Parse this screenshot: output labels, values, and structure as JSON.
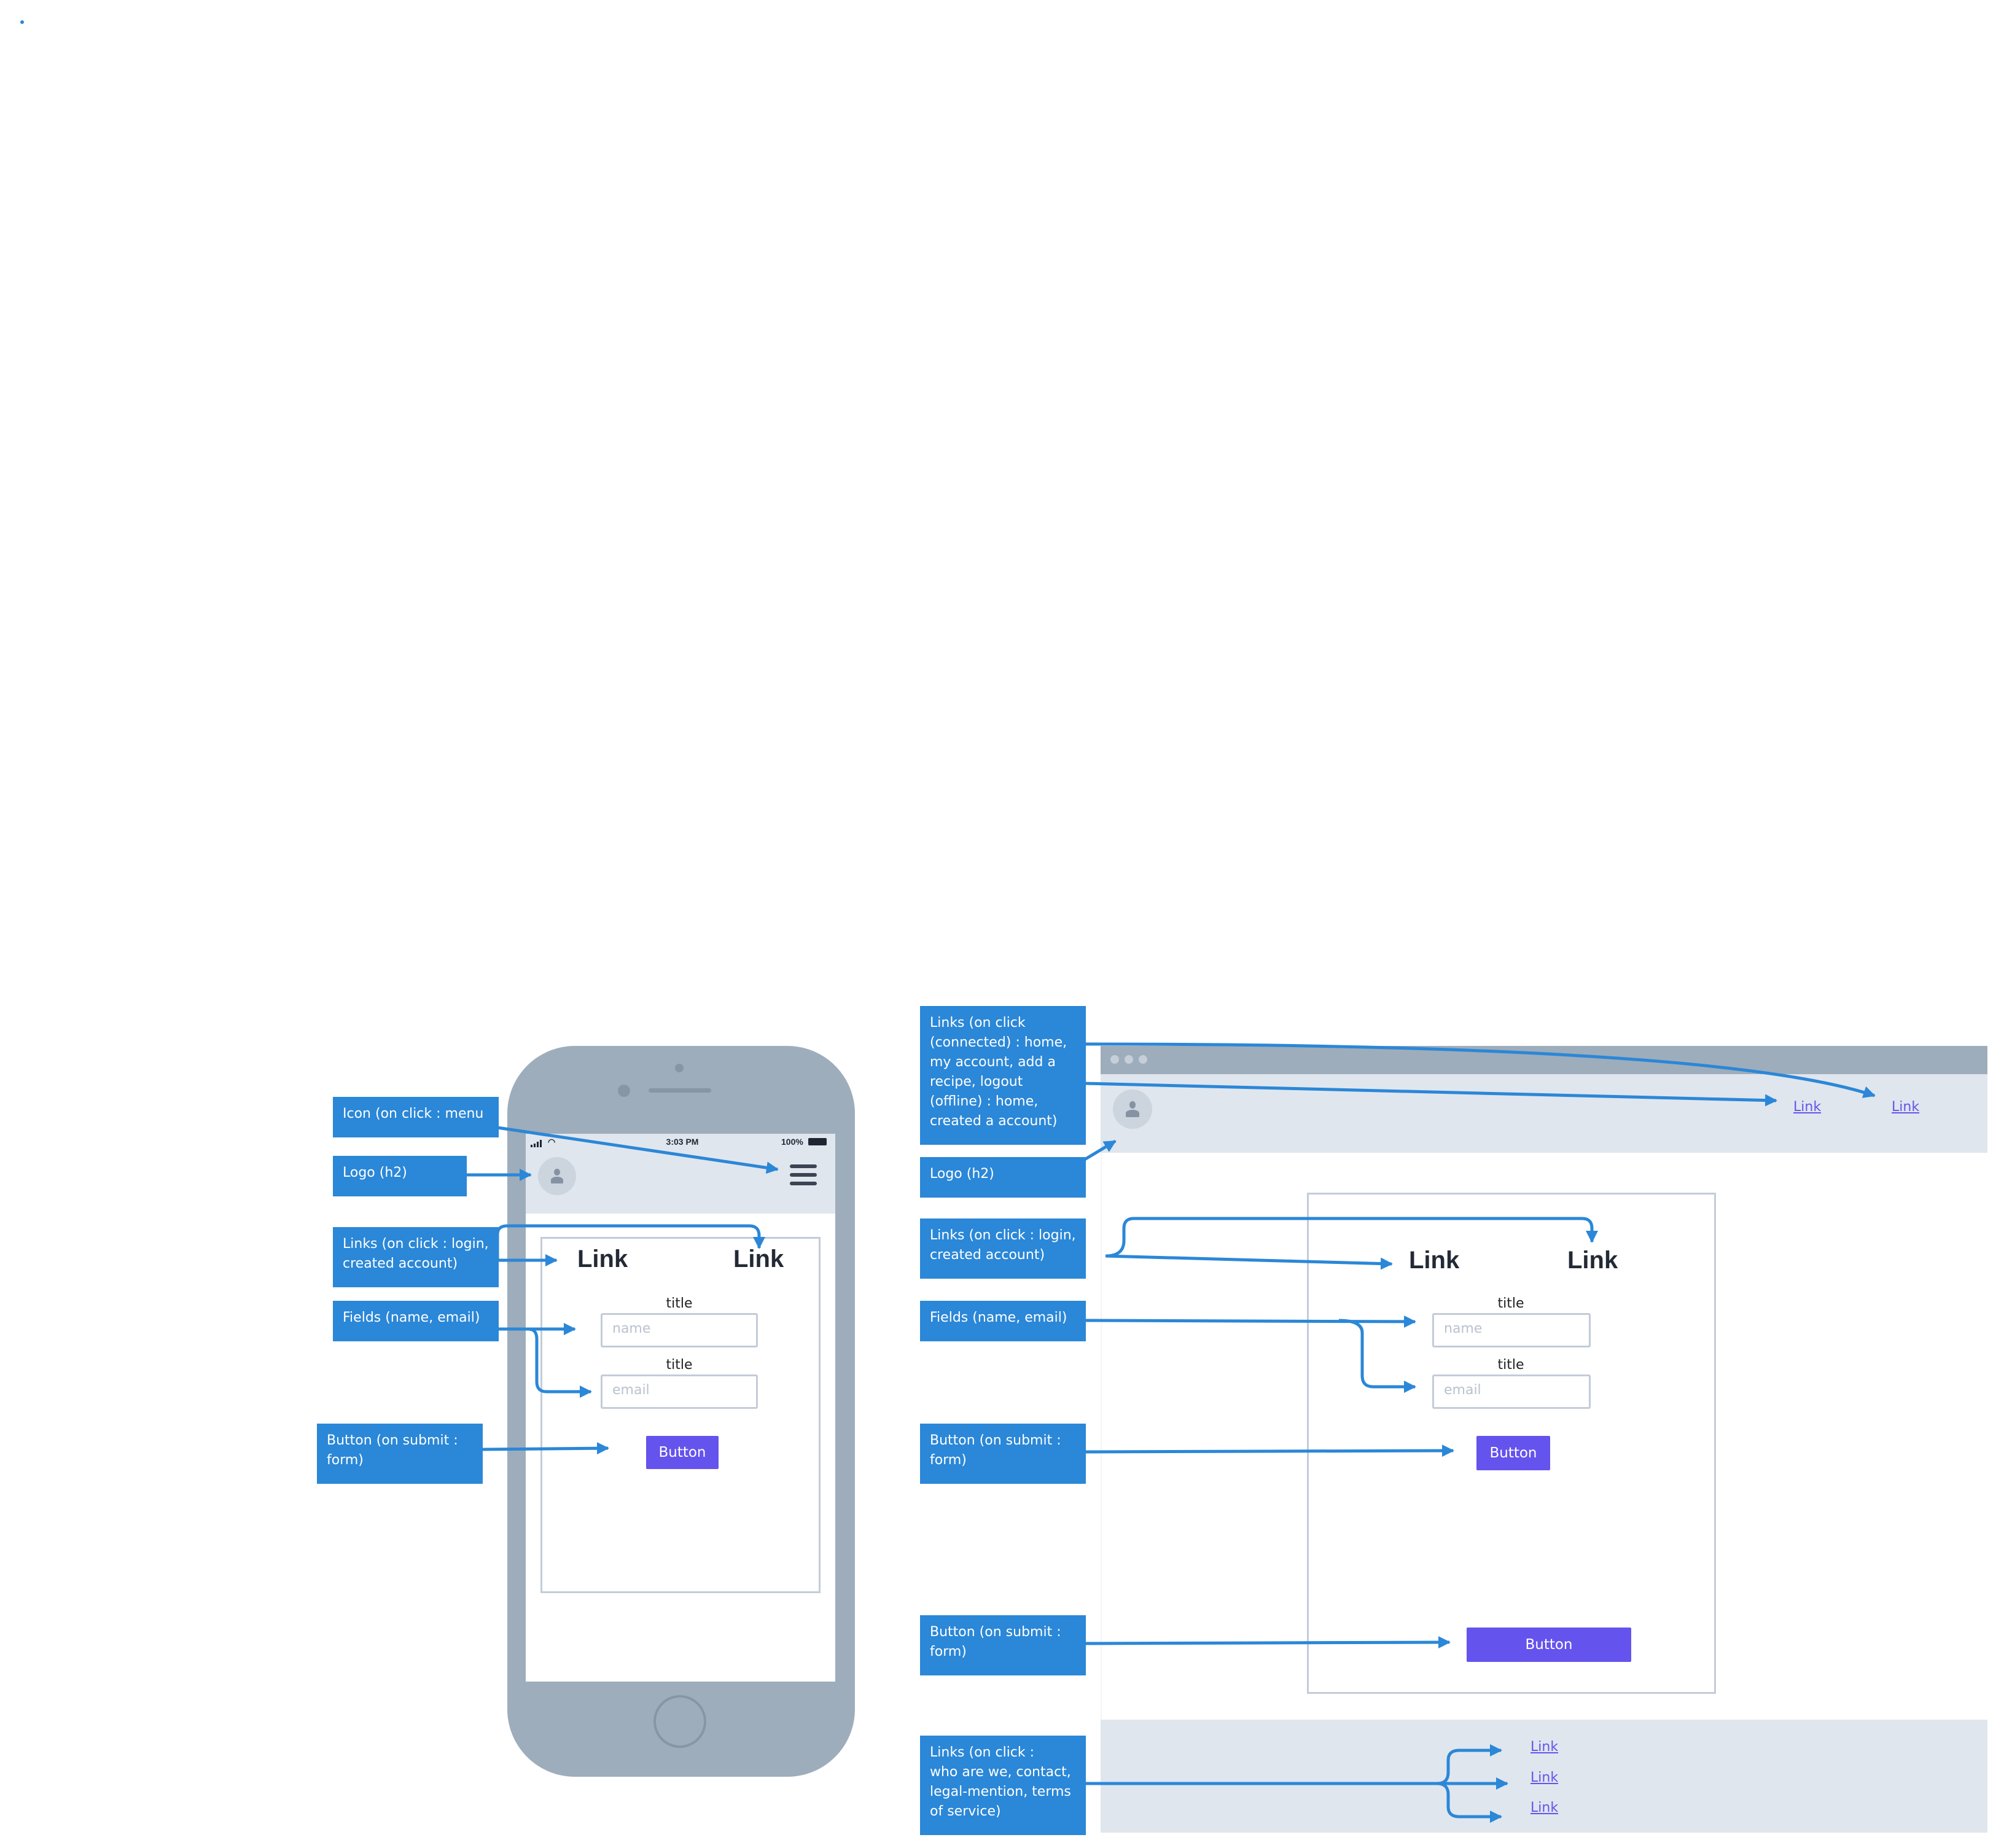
{
  "notes": {
    "mobile_menu_icon": "Icon (on click : menu",
    "mobile_logo": "Logo (h2)",
    "mobile_links": "Links (on click : login,\ncreated account)",
    "mobile_fields": "Fields (name, email)",
    "mobile_button": "Button (on submit :\nform)",
    "desktop_nav_links": "Links (on click\n(connected) : home,\nmy account, add a\nrecipe, logout\n(offline) : home,\ncreated a account)",
    "desktop_logo": "Logo (h2)",
    "desktop_links": "Links (on click : login,\ncreated account)",
    "desktop_fields": "Fields (name, email)",
    "desktop_button_1": "Button (on submit :\nform)",
    "desktop_button_2": "Button (on submit :\nform)",
    "desktop_footer_links": "Links (on click :\nwho are we, contact,\nlegal-mention, terms\nof service)"
  },
  "mobile": {
    "status_time": "3:03 PM",
    "status_battery": "100%",
    "link_1": "Link",
    "link_2": "Link",
    "field_1_title": "title",
    "field_1_placeholder": "name",
    "field_2_title": "title",
    "field_2_placeholder": "email",
    "button_label": "Button"
  },
  "desktop": {
    "nav_link_1": "Link",
    "nav_link_2": "Link",
    "link_1": "Link",
    "link_2": "Link",
    "field_1_title": "title",
    "field_1_placeholder": "name",
    "field_2_title": "title",
    "field_2_placeholder": "email",
    "button_1_label": "Button",
    "button_2_label": "Button",
    "footer_link_1": "Link",
    "footer_link_2": "Link",
    "footer_link_3": "Link"
  },
  "colors": {
    "annotation": "#2b87d7",
    "button": "#6553ed",
    "device_frame": "#9eadbb",
    "band": "#e0e6ee"
  }
}
